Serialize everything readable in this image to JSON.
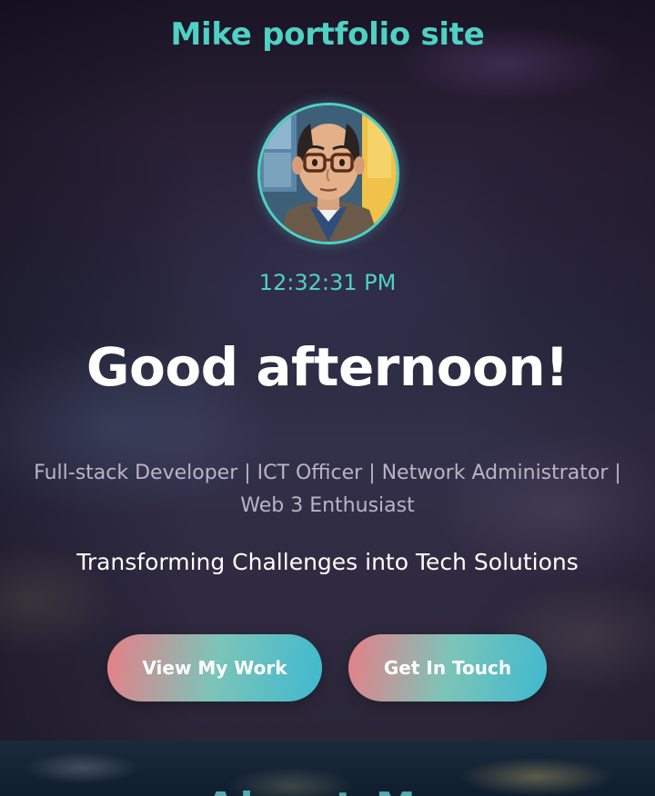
{
  "site": {
    "title": "Mike portfolio site"
  },
  "hero": {
    "avatar_alt": "avatar",
    "clock": "12:32:31 PM",
    "greeting": "Good afternoon!",
    "roles": "Full-stack Developer | ICT Officer | Network Administrator | Web 3 Enthusiast",
    "tagline": "Transforming Challenges into Tech Solutions",
    "buttons": {
      "view_work": "View My Work",
      "get_in_touch": "Get In Touch"
    }
  },
  "next_section": {
    "heading_partial": "About Me"
  },
  "colors": {
    "accent": "#4fd1c5",
    "button_gradient_start": "#e77f86",
    "button_gradient_end": "#3fb9cf",
    "text_primary": "#ffffff",
    "text_muted": "#b9b5c4"
  }
}
